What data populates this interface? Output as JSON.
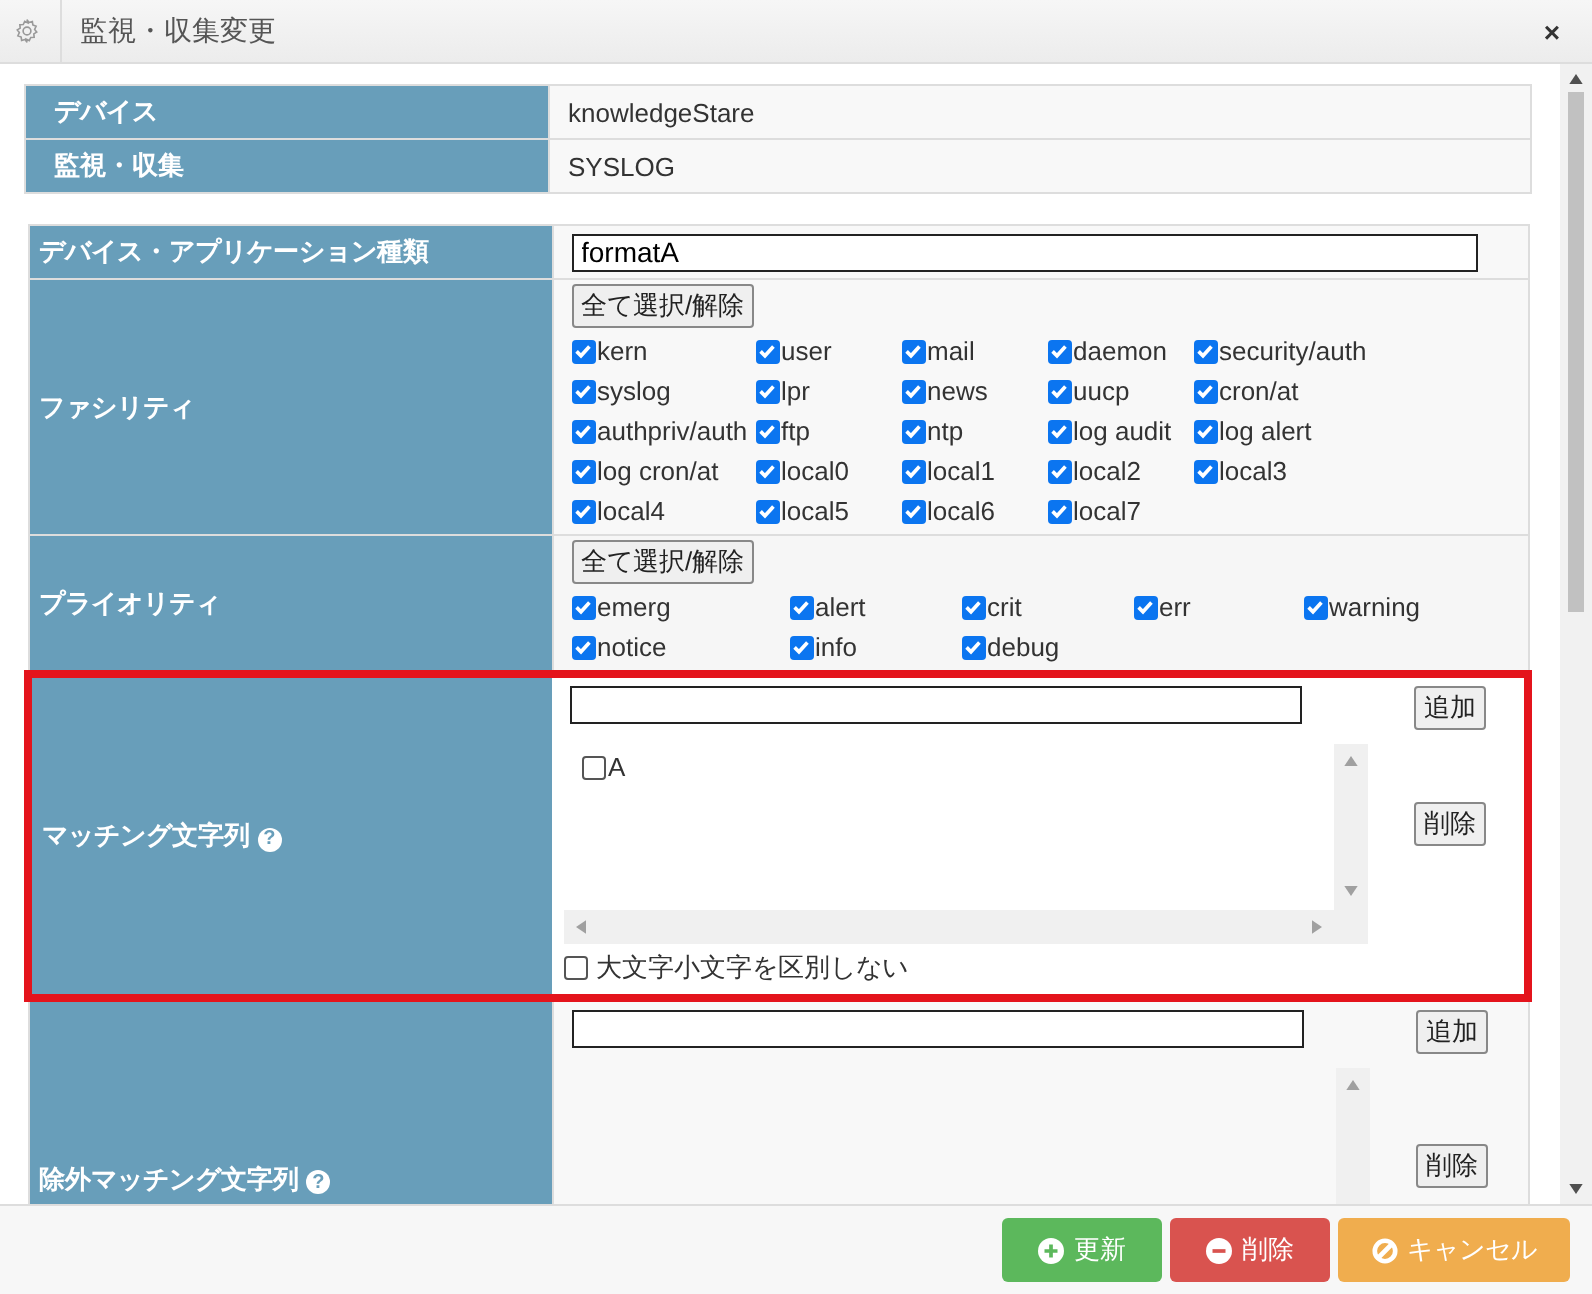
{
  "dialog": {
    "title": "監視・収集変更",
    "close": "×"
  },
  "info_rows": [
    {
      "label": "デバイス",
      "value": "knowledgeStare"
    },
    {
      "label": "監視・収集",
      "value": "SYSLOG"
    }
  ],
  "form": {
    "app_type": {
      "label": "デバイス・アプリケーション種類",
      "value": "formatA"
    },
    "facility": {
      "label": "ファシリティ",
      "toggle_button": "全て選択/解除",
      "options": [
        {
          "label": "kern",
          "checked": true
        },
        {
          "label": "user",
          "checked": true
        },
        {
          "label": "mail",
          "checked": true
        },
        {
          "label": "daemon",
          "checked": true
        },
        {
          "label": "security/auth",
          "checked": true
        },
        {
          "label": "syslog",
          "checked": true
        },
        {
          "label": "lpr",
          "checked": true
        },
        {
          "label": "news",
          "checked": true
        },
        {
          "label": "uucp",
          "checked": true
        },
        {
          "label": "cron/at",
          "checked": true
        },
        {
          "label": "authpriv/auth",
          "checked": true
        },
        {
          "label": "ftp",
          "checked": true
        },
        {
          "label": "ntp",
          "checked": true
        },
        {
          "label": "log audit",
          "checked": true
        },
        {
          "label": "log alert",
          "checked": true
        },
        {
          "label": "log cron/at",
          "checked": true
        },
        {
          "label": "local0",
          "checked": true
        },
        {
          "label": "local1",
          "checked": true
        },
        {
          "label": "local2",
          "checked": true
        },
        {
          "label": "local3",
          "checked": true
        },
        {
          "label": "local4",
          "checked": true
        },
        {
          "label": "local5",
          "checked": true
        },
        {
          "label": "local6",
          "checked": true
        },
        {
          "label": "local7",
          "checked": true
        }
      ]
    },
    "priority": {
      "label": "プライオリティ",
      "toggle_button": "全て選択/解除",
      "options": [
        {
          "label": "emerg",
          "checked": true
        },
        {
          "label": "alert",
          "checked": true
        },
        {
          "label": "crit",
          "checked": true
        },
        {
          "label": "err",
          "checked": true
        },
        {
          "label": "warning",
          "checked": true
        },
        {
          "label": "notice",
          "checked": true
        },
        {
          "label": "info",
          "checked": true
        },
        {
          "label": "debug",
          "checked": true
        }
      ]
    },
    "matching": {
      "label": "マッチング文字列",
      "help": "?",
      "highlighted": true,
      "add_button": "追加",
      "delete_button": "削除",
      "entries": [
        {
          "label": "A",
          "checked": false
        }
      ],
      "case_option": {
        "label": "大文字小文字を区別しない",
        "checked": false
      }
    },
    "exclude_matching": {
      "label": "除外マッチング文字列",
      "help": "?",
      "highlighted": false,
      "add_button": "追加",
      "delete_button": "削除"
    }
  },
  "buttons": [
    {
      "kind": "update",
      "label": "更新"
    },
    {
      "kind": "delete",
      "label": "削除"
    },
    {
      "kind": "cancel",
      "label": "キャンセル"
    }
  ]
}
